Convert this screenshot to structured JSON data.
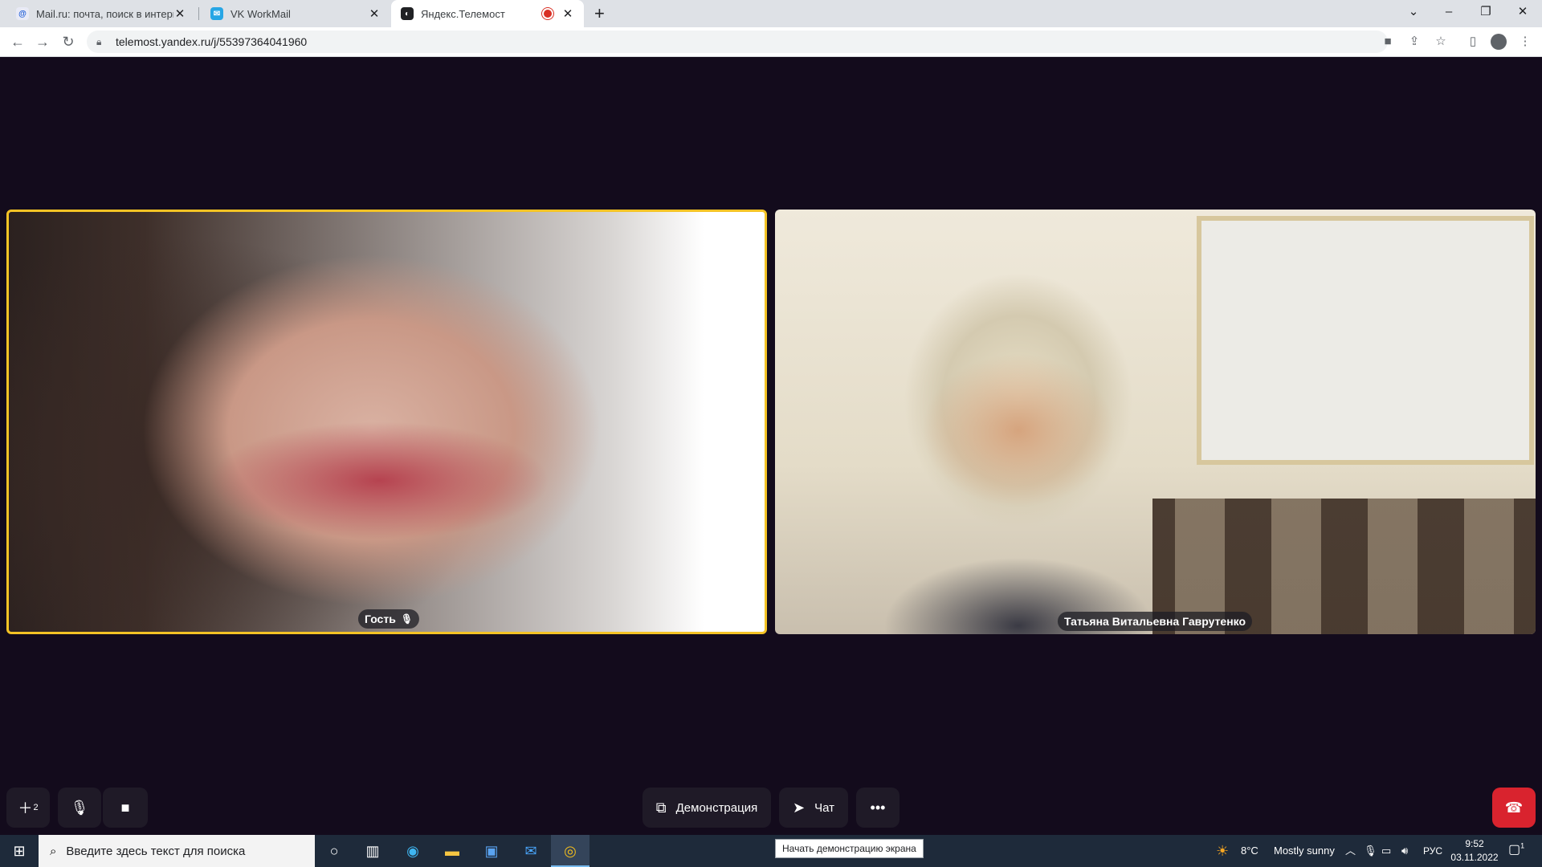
{
  "browser": {
    "tabs": [
      {
        "title": "Mail.ru: почта, поиск в интернете",
        "favicon": "@"
      },
      {
        "title": "VK WorkMail",
        "favicon": "✉"
      },
      {
        "title": "Яндекс.Телемост",
        "favicon": "◐",
        "active": true
      }
    ],
    "new_tab": "+",
    "url": "telemost.yandex.ru/j/55397364041960"
  },
  "meeting": {
    "participants": [
      {
        "name": "Гость",
        "speaking": true
      },
      {
        "name": "Татьяна Витальевна Гаврутенко"
      }
    ],
    "controls": {
      "screen_share_label": "Демонстрация",
      "chat_label": "Чат",
      "more_label": "•••",
      "participants_badge": "2"
    },
    "tooltip": "Начать демонстрацию экрана"
  },
  "taskbar": {
    "search_placeholder": "Введите здесь текст для поиска",
    "weather_temp": "8°C",
    "weather_text": "Mostly sunny",
    "language": "РУС",
    "time": "9:52",
    "date": "03.11.2022",
    "notifications": "1"
  },
  "colors": {
    "background": "#130b1c",
    "active_speaker_border": "#f4c325",
    "end_call": "#d9232e",
    "control_bg": "#1f1a27"
  }
}
